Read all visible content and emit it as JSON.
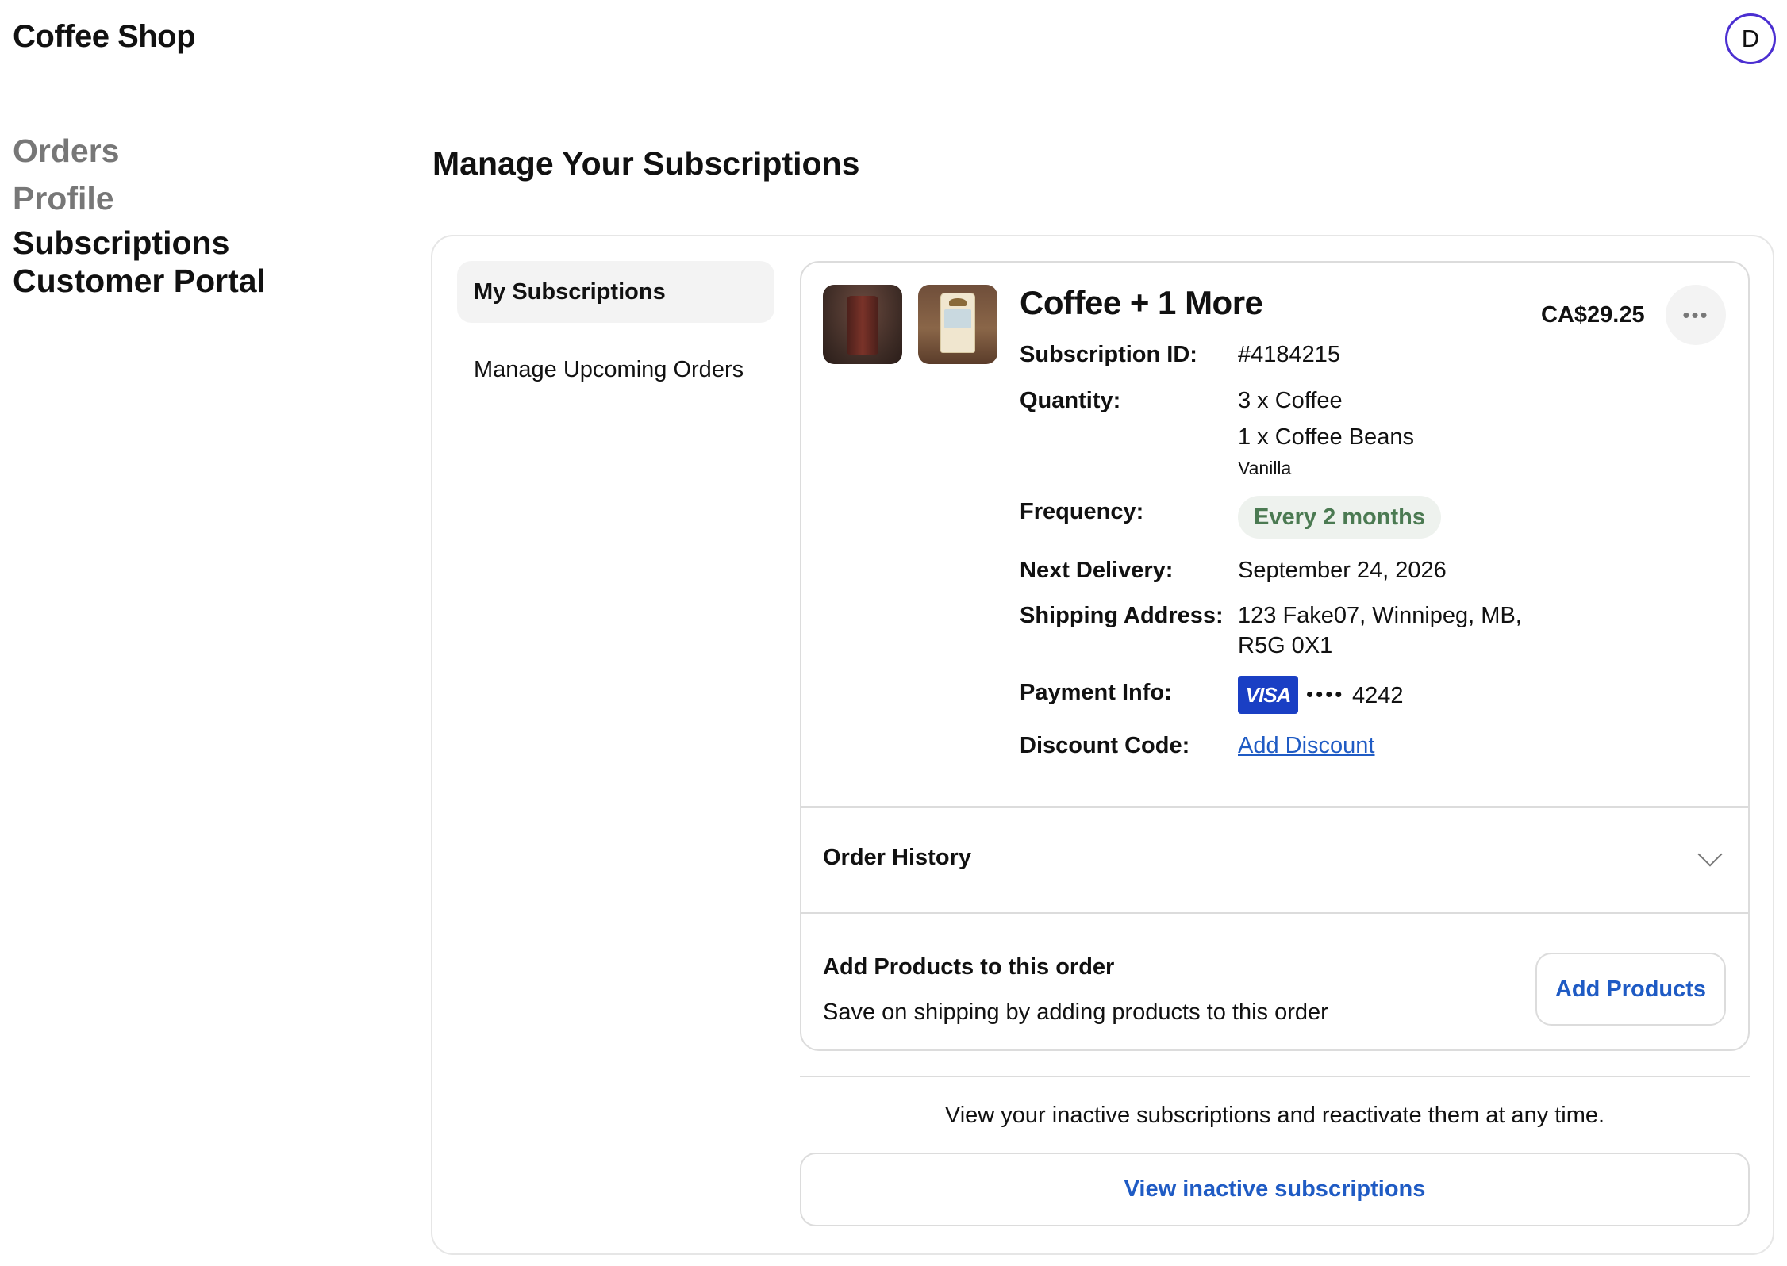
{
  "header": {
    "brand": "Coffee Shop",
    "avatar_initial": "D"
  },
  "sidebar": {
    "items": [
      {
        "label": "Orders",
        "active": false
      },
      {
        "label": "Profile",
        "active": false
      },
      {
        "label": "Subscriptions",
        "active": true
      },
      {
        "label": "Customer Portal",
        "active": true
      }
    ]
  },
  "main": {
    "title": "Manage Your Subscriptions",
    "subnav": [
      {
        "label": "My Subscriptions",
        "active": true
      },
      {
        "label": "Manage Upcoming Orders",
        "active": false
      }
    ],
    "subscription": {
      "title": "Coffee + 1 More",
      "price": "CA$29.25",
      "more_icon": "ellipsis-icon",
      "labels": {
        "id": "Subscription ID:",
        "quantity": "Quantity:",
        "frequency": "Frequency:",
        "next_delivery": "Next Delivery:",
        "shipping": "Shipping Address:",
        "payment": "Payment Info:",
        "discount": "Discount Code:"
      },
      "id": "#4184215",
      "quantity_lines": [
        "3 x Coffee",
        "1 x Coffee Beans"
      ],
      "variant": "Vanilla",
      "frequency": "Every 2 months",
      "next_delivery": "September 24, 2026",
      "shipping_lines": [
        "123 Fake07, Winnipeg, MB,",
        "R5G 0X1"
      ],
      "payment": {
        "brand": "VISA",
        "masked": "••••",
        "last4": "4242"
      },
      "discount_link": "Add Discount"
    },
    "order_history": {
      "label": "Order History",
      "icon": "chevron-down-icon"
    },
    "add_products": {
      "title": "Add Products to this order",
      "description": "Save on shipping by adding products to this order",
      "button": "Add Products"
    },
    "inactive": {
      "note": "View your inactive subscriptions and reactivate them at any time.",
      "button": "View inactive subscriptions"
    }
  },
  "colors": {
    "accent_link": "#1f5bc4",
    "frequency_text": "#4b7a52",
    "frequency_bg": "#eef2ee",
    "visa_blue": "#1a3fc4",
    "avatar_ring": "#4b2fd1"
  }
}
